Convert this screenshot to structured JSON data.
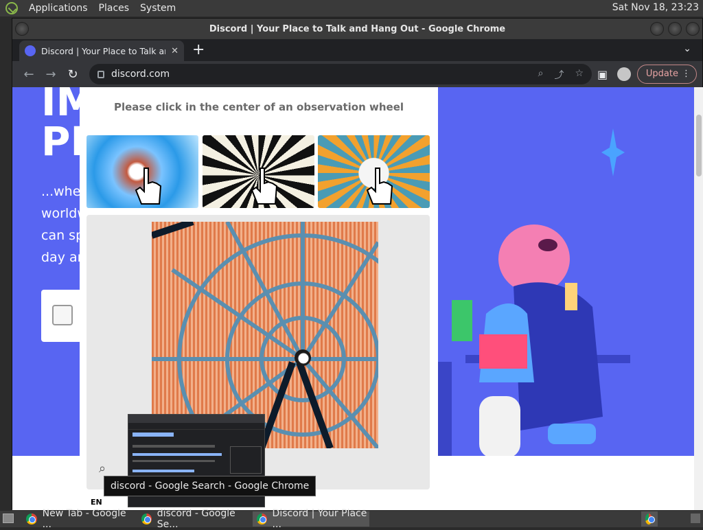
{
  "top_panel": {
    "menus": [
      "Applications",
      "Places",
      "System"
    ],
    "clock": "Sat Nov 18, 23:23"
  },
  "window": {
    "title": "Discord | Your Place to Talk and Hang Out - Google Chrome"
  },
  "tab": {
    "title": "Discord | Your Place to Talk and Hang Out",
    "close": "✕",
    "new_tab": "+",
    "menu": "⌄"
  },
  "toolbar": {
    "back": "←",
    "forward": "→",
    "reload": "↻",
    "url": "discord.com",
    "update_label": "Update",
    "more": "⋮"
  },
  "page": {
    "hero_title_lines": [
      "IM",
      "PL"
    ],
    "hero_text_lines": [
      "...wher",
      "worldw",
      "can sp",
      "day an"
    ]
  },
  "captcha": {
    "prompt": "Please click in the center of an observation wheel",
    "language": "EN"
  },
  "tooltip": {
    "text": "discord - Google Search - Google Chrome"
  },
  "taskbar": {
    "items": [
      {
        "label": "New Tab - Google ..."
      },
      {
        "label": "discord - Google Se..."
      },
      {
        "label": "Discord | Your Place ..."
      }
    ]
  },
  "colors": {
    "discord_blurple": "#5865f2",
    "chrome_dark": "#202124",
    "toolbar": "#35363a",
    "update_accent": "#e8a4a4"
  }
}
